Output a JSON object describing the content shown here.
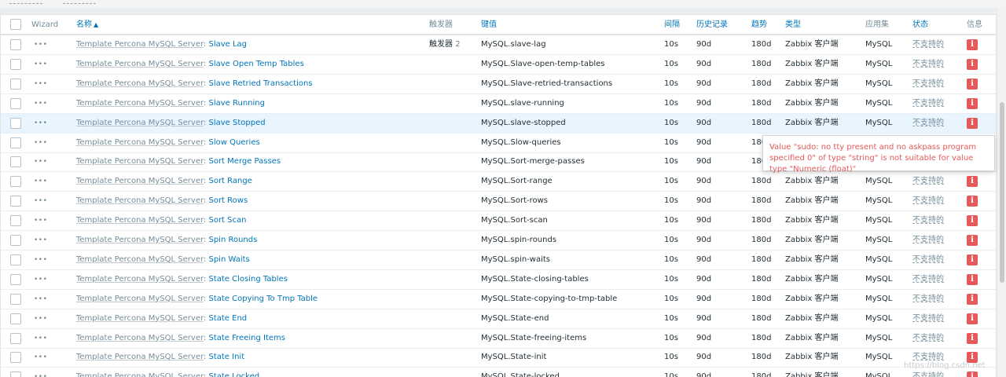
{
  "filter_dashes": [
    "------------",
    "------------"
  ],
  "header": {
    "wizard": "Wizard",
    "name": "名称",
    "sort_indicator": "▲",
    "triggers": "触发器",
    "key": "键值",
    "interval": "间隔",
    "history": "历史记录",
    "trends": "趋势",
    "type": "类型",
    "applications": "应用集",
    "status": "状态",
    "info": "信息"
  },
  "row_common": {
    "template": "Template Percona MySQL Server",
    "separator": ":",
    "interval": "10s",
    "history": "90d",
    "trends": "180d",
    "type": "Zabbix 客户端",
    "application": "MySQL",
    "status": "不支持的",
    "info_icon": "i",
    "wizard_icon": "•••"
  },
  "rows": [
    {
      "name": "Slave Lag",
      "triggers": "触发器",
      "trigger_count": "2",
      "key": "MySQL.slave-lag"
    },
    {
      "name": "Slave Open Temp Tables",
      "triggers": "",
      "trigger_count": "",
      "key": "MySQL.Slave-open-temp-tables"
    },
    {
      "name": "Slave Retried Transactions",
      "triggers": "",
      "trigger_count": "",
      "key": "MySQL.Slave-retried-transactions"
    },
    {
      "name": "Slave Running",
      "triggers": "",
      "trigger_count": "",
      "key": "MySQL.slave-running"
    },
    {
      "name": "Slave Stopped",
      "triggers": "",
      "trigger_count": "",
      "key": "MySQL.slave-stopped",
      "highlighted": true
    },
    {
      "name": "Slow Queries",
      "triggers": "",
      "trigger_count": "",
      "key": "MySQL.Slow-queries"
    },
    {
      "name": "Sort Merge Passes",
      "triggers": "",
      "trigger_count": "",
      "key": "MySQL.Sort-merge-passes"
    },
    {
      "name": "Sort Range",
      "triggers": "",
      "trigger_count": "",
      "key": "MySQL.Sort-range"
    },
    {
      "name": "Sort Rows",
      "triggers": "",
      "trigger_count": "",
      "key": "MySQL.Sort-rows"
    },
    {
      "name": "Sort Scan",
      "triggers": "",
      "trigger_count": "",
      "key": "MySQL.Sort-scan"
    },
    {
      "name": "Spin Rounds",
      "triggers": "",
      "trigger_count": "",
      "key": "MySQL.spin-rounds"
    },
    {
      "name": "Spin Waits",
      "triggers": "",
      "trigger_count": "",
      "key": "MySQL.spin-waits"
    },
    {
      "name": "State Closing Tables",
      "triggers": "",
      "trigger_count": "",
      "key": "MySQL.State-closing-tables"
    },
    {
      "name": "State Copying To Tmp Table",
      "triggers": "",
      "trigger_count": "",
      "key": "MySQL.State-copying-to-tmp-table"
    },
    {
      "name": "State End",
      "triggers": "",
      "trigger_count": "",
      "key": "MySQL.State-end"
    },
    {
      "name": "State Freeing Items",
      "triggers": "",
      "trigger_count": "",
      "key": "MySQL.State-freeing-items"
    },
    {
      "name": "State Init",
      "triggers": "",
      "trigger_count": "",
      "key": "MySQL.State-init"
    },
    {
      "name": "State Locked",
      "triggers": "",
      "trigger_count": "",
      "key": "MySQL.State-locked"
    }
  ],
  "tooltip": {
    "text": "Value \"sudo: no tty present and no askpass program specified 0\" of type \"string\" is not suitable for value type \"Numeric (float)\""
  },
  "watermark": "https://blog.csdn.net",
  "colors": {
    "link": "#0275b8",
    "muted": "#768d99",
    "error": "#e45959",
    "row_highlight": "#e8f5ff",
    "page_bg": "#ebeef0"
  }
}
